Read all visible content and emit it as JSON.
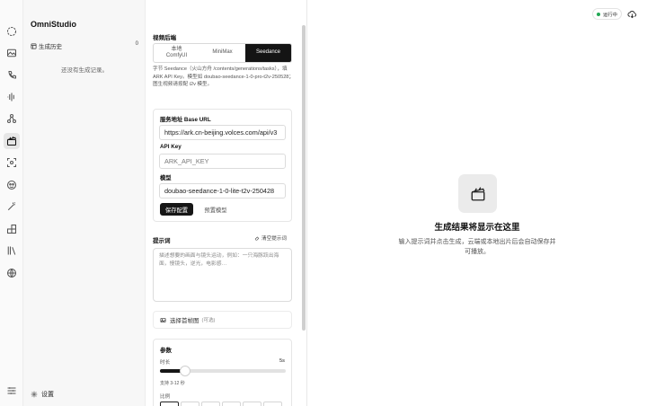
{
  "rail": {
    "items": [
      {
        "name": "chat-icon"
      },
      {
        "name": "image-icon"
      },
      {
        "name": "phone-icon"
      },
      {
        "name": "audio-wave-icon"
      },
      {
        "name": "nodes-icon"
      },
      {
        "name": "clapperboard-icon",
        "active": true
      },
      {
        "name": "scan-icon"
      },
      {
        "name": "mask-icon"
      },
      {
        "name": "magic-wand-icon"
      },
      {
        "name": "blocks-icon"
      },
      {
        "name": "library-icon"
      },
      {
        "name": "globe-icon"
      }
    ],
    "bottom_icon": "sliders-icon"
  },
  "sidebar": {
    "brand": "OmniStudio",
    "history_label": "生成历史",
    "history_count": "0",
    "empty_text": "还没有生成记录。",
    "settings_label": "设置"
  },
  "panel": {
    "backend_label": "视频后端",
    "segments": [
      {
        "label": "本地\nComfyUI",
        "active": false
      },
      {
        "label": "MiniMax",
        "active": false
      },
      {
        "label": "Seedance",
        "active": true
      }
    ],
    "description": "字节 Seedance（火山方舟 /contents/generations/tasks），填ARK API Key。模型如 doubao-seedance-1-0-pro-t2v-250528；图生视频请按配 i2v 模型。",
    "base_url_label": "服务地址 Base URL",
    "base_url_value": "https://ark.cn-beijing.volces.com/api/v3",
    "api_key_label": "API Key",
    "api_key_placeholder": "ARK_API_KEY",
    "model_label": "模型",
    "model_value": "doubao-seedance-1-0-lite-t2v-250428",
    "save_button": "保存配置",
    "preset_button": "预置模型",
    "prompt_label": "提示词",
    "clear_prompt": "清空提示词",
    "prompt_placeholder": "描述想要的画面与镜头运动，例如：一只海豚跃出海面，慢镜头，逆光，电影感…",
    "upload_label": "选择首帧图",
    "upload_optional": "(可选)",
    "params_label": "参数",
    "duration_label": "时长",
    "duration_value": "5s",
    "duration_fraction": 0.2,
    "duration_hint": "支持 3-12 秒",
    "ratio_label": "比例"
  },
  "preview": {
    "status_label": "运行中",
    "status_color": "#22a855",
    "cloud_icon": "cloud-sync-icon",
    "empty_icon": "clapperboard-icon",
    "empty_title": "生成结果将显示在这里",
    "empty_desc": "输入提示词并点击生成，云端或本地出片后会自动保存并可播放。"
  }
}
